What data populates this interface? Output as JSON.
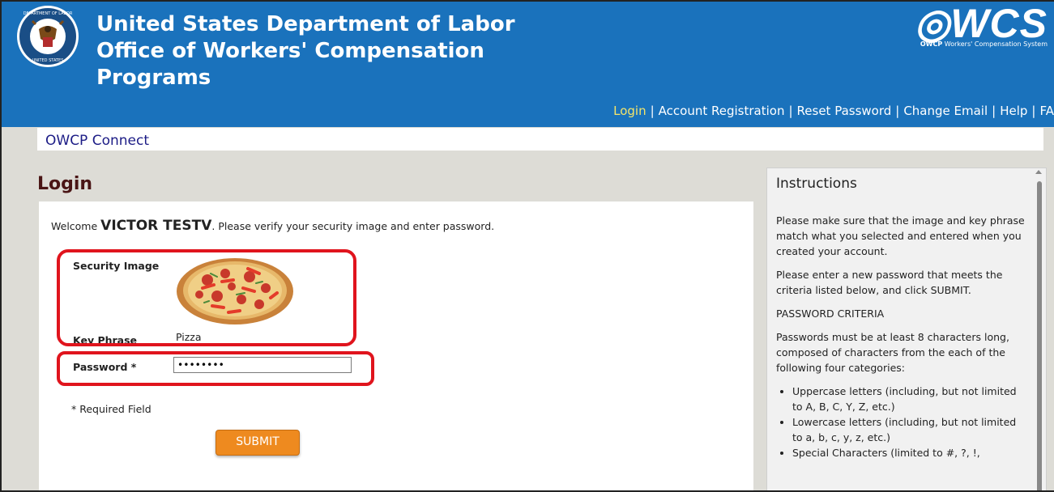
{
  "header": {
    "title_lines": [
      "United States Department of Labor",
      "Office of Workers' Compensation",
      "Programs"
    ],
    "logo_text": "WCS",
    "logo_sub_brand": "OWCP",
    "logo_sub_rest": "Workers' Compensation System",
    "brand_color": "#1a72bc",
    "nav": [
      {
        "label": "Login",
        "active": true
      },
      {
        "label": "Account Registration"
      },
      {
        "label": "Reset Password"
      },
      {
        "label": "Change Email"
      },
      {
        "label": "Help"
      },
      {
        "label": "FA"
      }
    ],
    "nav_separator": "|",
    "seal_icon": "dol-seal-icon"
  },
  "breadcrumb": "OWCP Connect",
  "page_title": "Login",
  "login": {
    "welcome_prefix": "Welcome ",
    "user_name": "VICTOR TESTV",
    "welcome_suffix": ". Please verify your security image and enter password.",
    "security_image_label": "Security Image",
    "security_image_icon": "pizza-image",
    "key_phrase_label": "Key Phrase",
    "key_phrase_value": "Pizza",
    "password_label": "Password *",
    "password_value": "••••••••",
    "required_note": "* Required Field",
    "submit_label": "SUBMIT",
    "highlight_color": "#e0141d",
    "button_color": "#ee8a1f"
  },
  "instructions": {
    "title": "Instructions",
    "p1": "Please make sure that the image and key phrase match what you selected and entered when you created your account.",
    "p2": "Please enter a new password that meets the criteria listed below, and click SUBMIT.",
    "criteria_heading": "PASSWORD CRITERIA",
    "p3": "Passwords must be at least 8 characters long, composed of characters from the each of the following four categories:",
    "bullets": [
      "Uppercase letters (including, but not limited to A, B, C, Y, Z, etc.)",
      "Lowercase letters (including, but not limited to a, b, c, y, z, etc.)",
      "Special Characters (limited to #, ?, !,"
    ]
  }
}
